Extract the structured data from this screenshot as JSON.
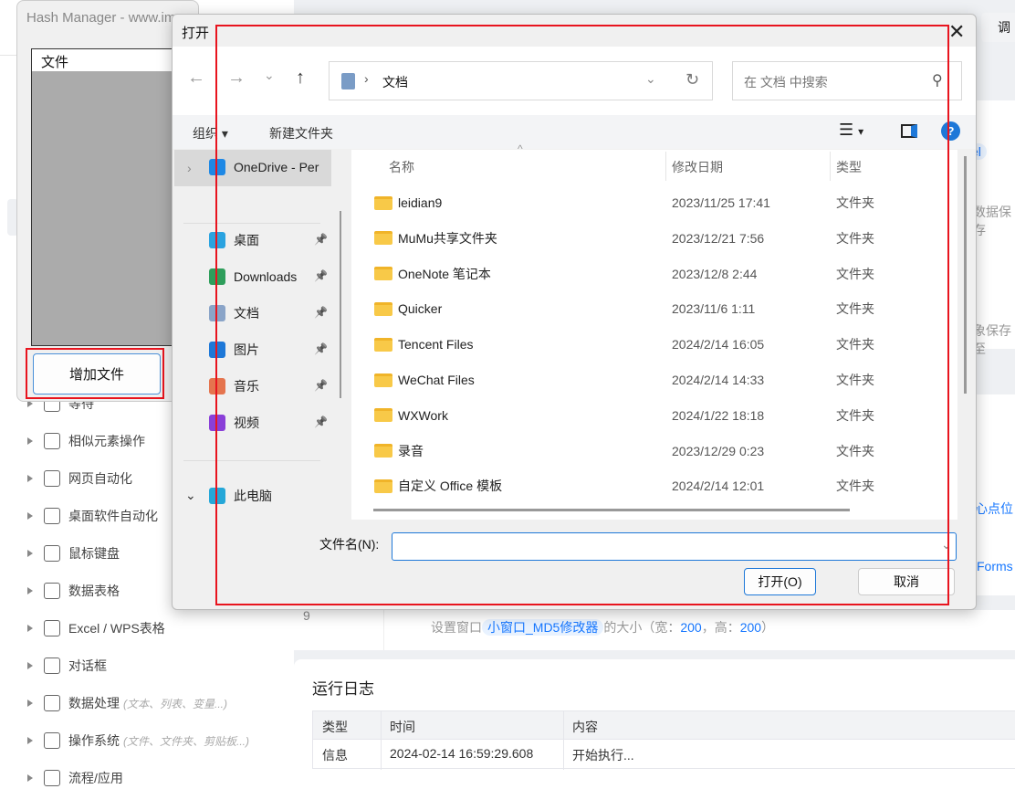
{
  "app": {
    "top_button": "调",
    "sidebar": [
      {
        "label": "等待",
        "hint": ""
      },
      {
        "label": "相似元素操作",
        "hint": ""
      },
      {
        "label": "网页自动化",
        "hint": ""
      },
      {
        "label": "桌面软件自动化",
        "hint": ""
      },
      {
        "label": "鼠标键盘",
        "hint": ""
      },
      {
        "label": "数据表格",
        "hint": ""
      },
      {
        "label": "Excel / WPS表格",
        "hint": ""
      },
      {
        "label": "对话框",
        "hint": ""
      },
      {
        "label": "数据处理",
        "hint": "(文本、列表、变量...)"
      },
      {
        "label": "操作系统",
        "hint": "(文件、文件夹、剪贴板...)"
      },
      {
        "label": "流程/应用",
        "hint": ""
      }
    ],
    "right_fragments": {
      "a": "el",
      "b": "数据保存",
      "c": "象保存至",
      "d": "心点位",
      "e": "Forms"
    },
    "step": {
      "index": "9",
      "prefix": "设置窗口",
      "window": "小窗口_MD5修改器",
      "mid": "的大小（宽：",
      "w": "200",
      "sep": "，高：",
      "h": "200",
      "end": "）"
    },
    "log": {
      "title": "运行日志",
      "headers": [
        "类型",
        "时间",
        "内容"
      ],
      "rows": [
        [
          "信息",
          "2024-02-14 16:59:29.608",
          "开始执行..."
        ]
      ]
    }
  },
  "hash": {
    "title": "Hash Manager - www.im...  ...  ...",
    "list_header": "文件",
    "add_button": "增加文件"
  },
  "dialog": {
    "title": "打开",
    "address": "文档",
    "search_placeholder": "在 文档 中搜索",
    "toolbar": {
      "organize": "组织",
      "new_folder": "新建文件夹"
    },
    "nav": [
      {
        "label": "OneDrive - Per",
        "color": "#1e88e5"
      },
      {
        "label": "桌面",
        "color": "#2aa3e0",
        "pin": true
      },
      {
        "label": "Downloads",
        "color": "#2e9e5b",
        "pin": true
      },
      {
        "label": "文档",
        "color": "#8aa4c8",
        "pin": true
      },
      {
        "label": "图片",
        "color": "#1e78d8",
        "pin": true
      },
      {
        "label": "音乐",
        "color": "#e5744e",
        "pin": true
      },
      {
        "label": "视频",
        "color": "#8a3fd8",
        "pin": true
      },
      {
        "label": "此电脑",
        "color": "#25a7d8"
      }
    ],
    "columns": [
      "名称",
      "修改日期",
      "类型"
    ],
    "files": [
      {
        "name": "leidian9",
        "date": "2023/11/25 17:41",
        "type": "文件夹"
      },
      {
        "name": "MuMu共享文件夹",
        "date": "2023/12/21 7:56",
        "type": "文件夹"
      },
      {
        "name": "OneNote 笔记本",
        "date": "2023/12/8 2:44",
        "type": "文件夹"
      },
      {
        "name": "Quicker",
        "date": "2023/11/6 1:11",
        "type": "文件夹"
      },
      {
        "name": "Tencent Files",
        "date": "2024/2/14 16:05",
        "type": "文件夹"
      },
      {
        "name": "WeChat Files",
        "date": "2024/2/14 14:33",
        "type": "文件夹"
      },
      {
        "name": "WXWork",
        "date": "2024/1/22 18:18",
        "type": "文件夹"
      },
      {
        "name": "录音",
        "date": "2023/12/29 0:23",
        "type": "文件夹"
      },
      {
        "name": "自定义 Office 模板",
        "date": "2024/2/14 12:01",
        "type": "文件夹"
      }
    ],
    "filename_label": "文件名(N):",
    "filename_value": "",
    "open_button": "打开(O)",
    "cancel_button": "取消"
  },
  "highlight_color": "#e8141e"
}
